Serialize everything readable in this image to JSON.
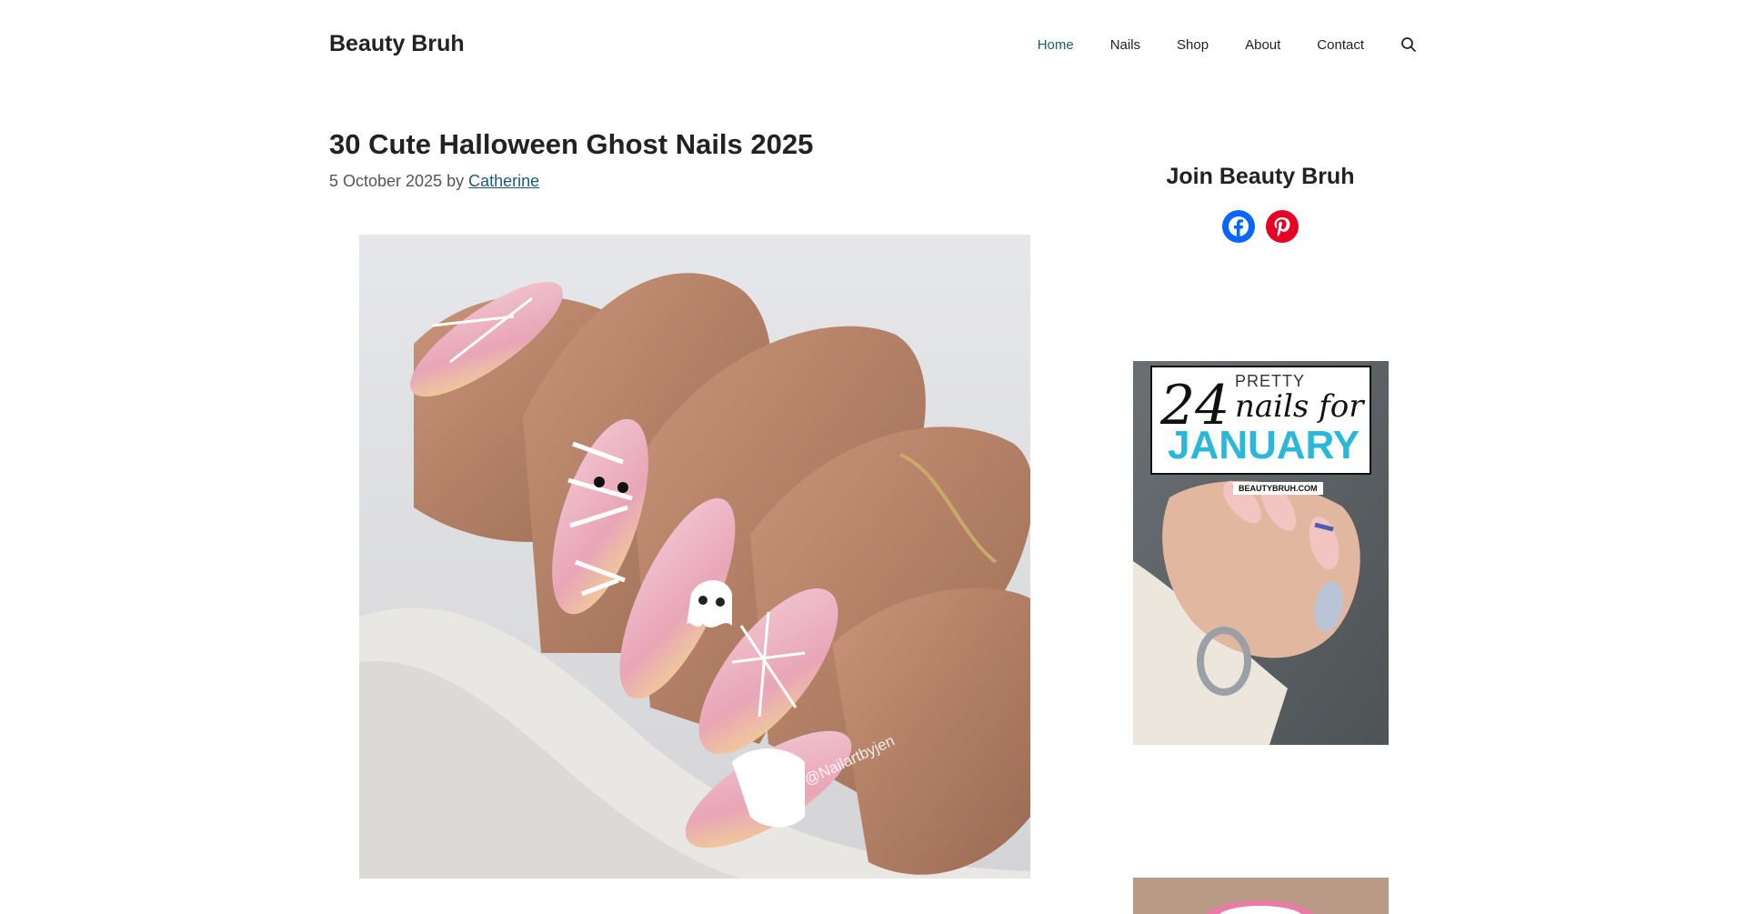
{
  "site": {
    "title": "Beauty Bruh"
  },
  "nav": {
    "items": [
      {
        "label": "Home",
        "active": true
      },
      {
        "label": "Nails"
      },
      {
        "label": "Shop"
      },
      {
        "label": "About"
      },
      {
        "label": "Contact"
      }
    ],
    "search_icon": "search-icon"
  },
  "post": {
    "title": "30 Cute Halloween Ghost Nails 2025",
    "date": "5 October 2025",
    "by": "by",
    "author": "Catherine",
    "image_watermark": "@Nailartbyjen"
  },
  "sidebar": {
    "widget_title": "Join Beauty Bruh",
    "social": [
      {
        "name": "facebook-icon",
        "color": "#0866ff"
      },
      {
        "name": "pinterest-icon",
        "color": "#e60023"
      }
    ],
    "ad": {
      "number": "24",
      "pretty": "PRETTY",
      "line2": "nails for",
      "month": "JANUARY",
      "domain": "BEAUTYBRUH.COM"
    }
  },
  "colors": {
    "link": "#1e5a78",
    "accent": "#2bb7d8"
  }
}
